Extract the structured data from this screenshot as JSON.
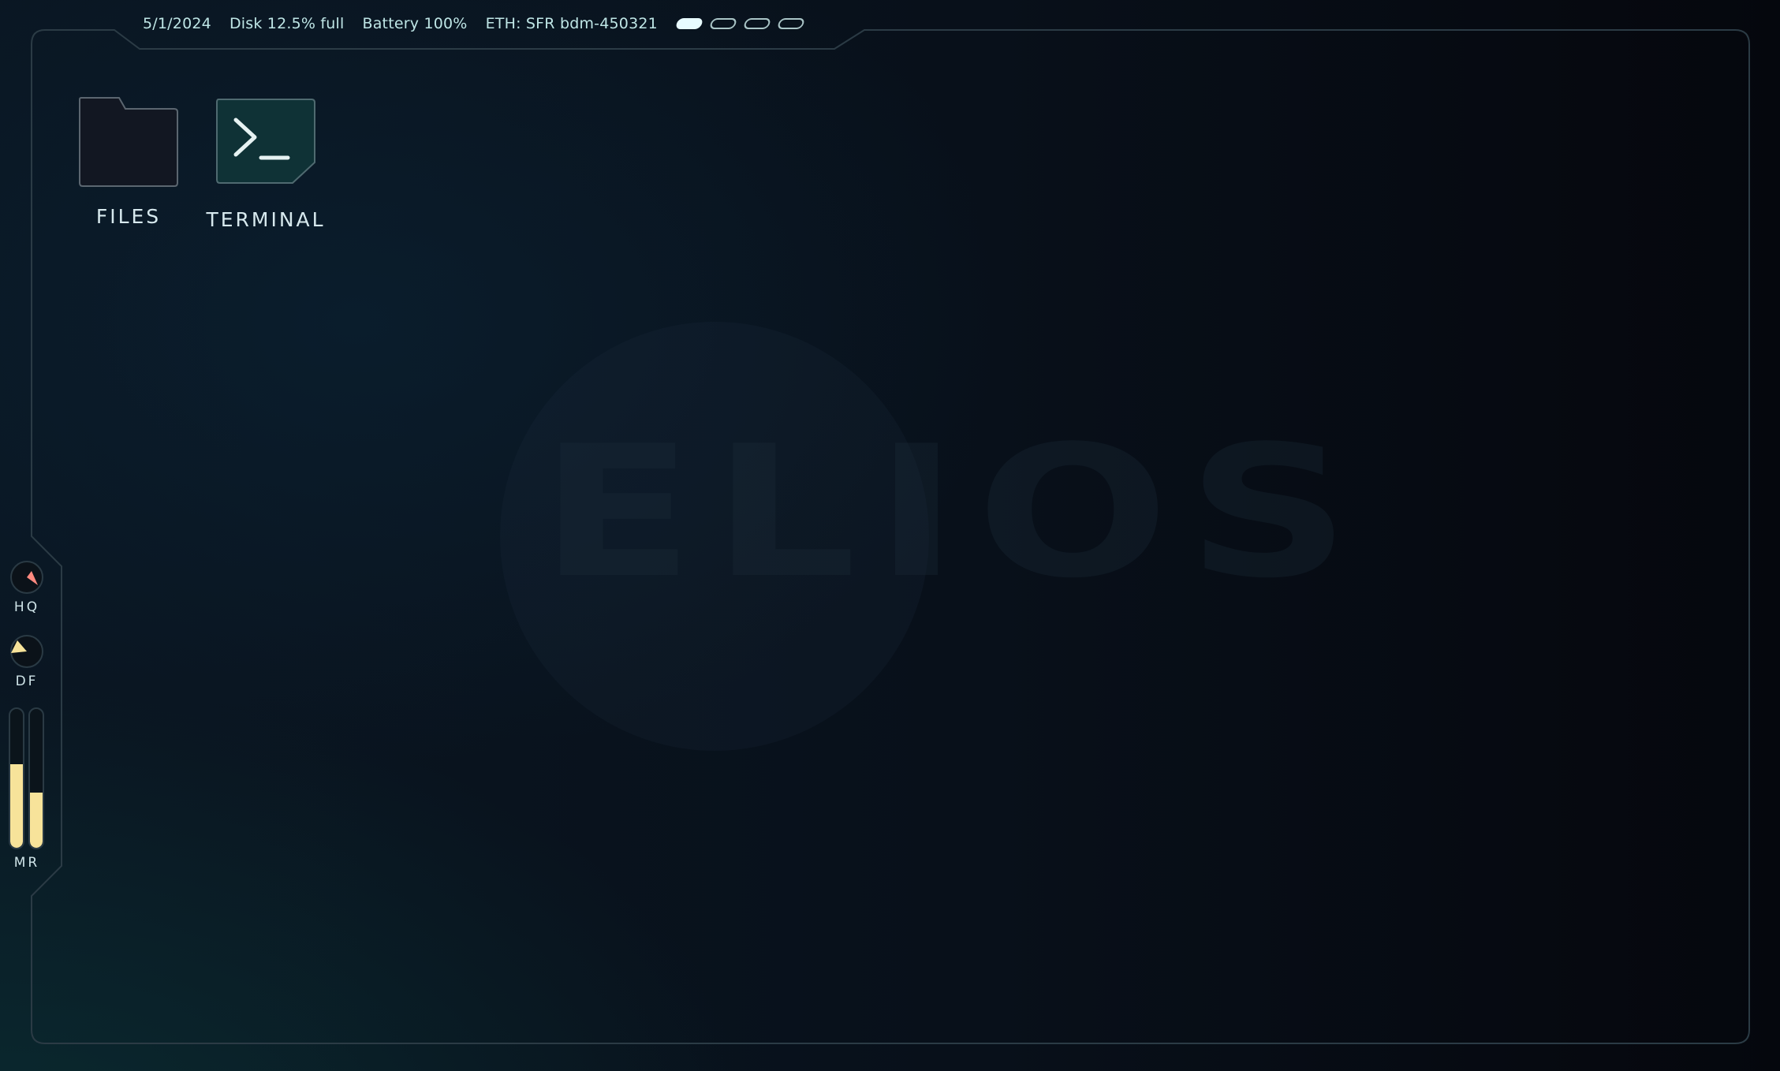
{
  "status_bar": {
    "date": "5/1/2024",
    "disk": "Disk 12.5% full",
    "battery": "Battery 100%",
    "network": "ETH: SFR bdm-450321",
    "workspaces": [
      {
        "active": true
      },
      {
        "active": false
      },
      {
        "active": false
      },
      {
        "active": false
      }
    ]
  },
  "desktop": {
    "watermark": "ELIOS",
    "icons": [
      {
        "label": "FILES",
        "icon": "folder-icon"
      },
      {
        "label": "TERMINAL",
        "icon": "terminal-icon"
      }
    ]
  },
  "side_panel": {
    "gauges": [
      {
        "label": "HQ",
        "color": "#ff8a80"
      },
      {
        "label": "DF",
        "color": "#f7e39a"
      }
    ],
    "meters_label": "MR",
    "meter_levels": [
      0.6,
      0.4
    ],
    "meter_color": "#f7e39a"
  },
  "colors": {
    "accent": "#bfe6e6",
    "frame": "#2b3b45",
    "terminal_tile": "#0f3236"
  }
}
